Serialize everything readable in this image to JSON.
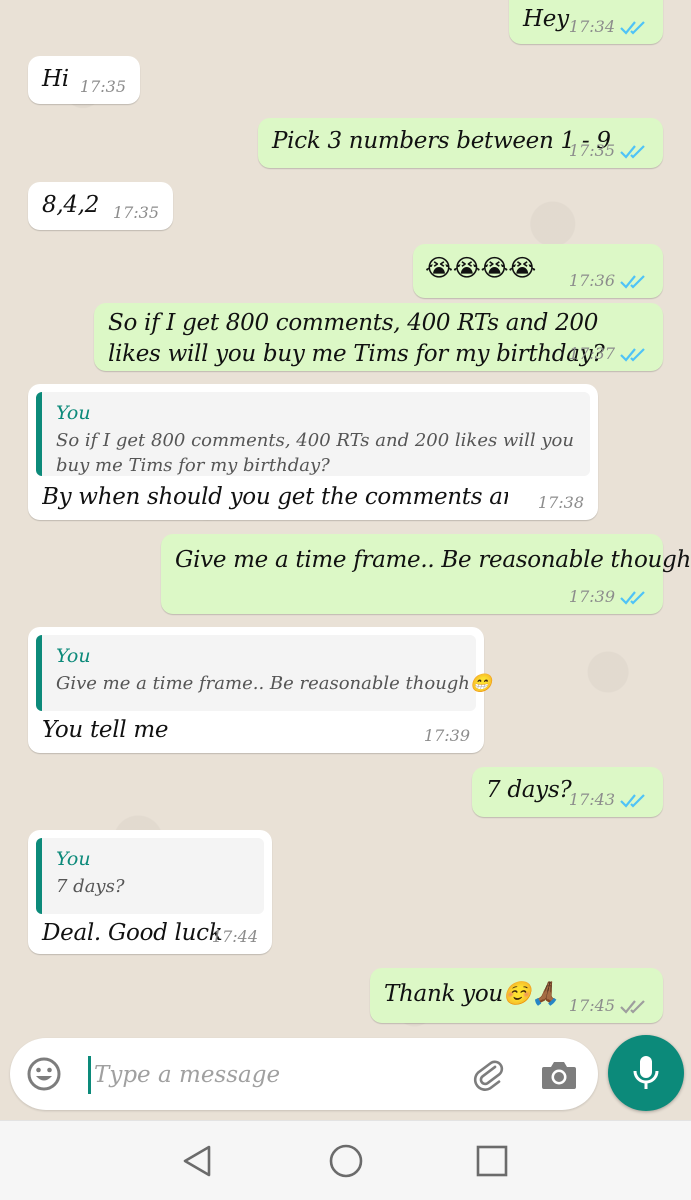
{
  "messages": [
    {
      "id": "m1",
      "dir": "out",
      "text": "Hey",
      "time": "17:34",
      "read": true
    },
    {
      "id": "m2",
      "dir": "in",
      "text": "Hi",
      "time": "17:35"
    },
    {
      "id": "m3",
      "dir": "out",
      "text": "Pick 3 numbers between 1 - 9",
      "time": "17:35",
      "read": true
    },
    {
      "id": "m4",
      "dir": "in",
      "text": "8,4,2",
      "time": "17:35"
    },
    {
      "id": "m5",
      "dir": "out",
      "text": "😭😭😭😭",
      "time": "17:36",
      "read": true
    },
    {
      "id": "m6",
      "dir": "out",
      "text": "So if I get 800 comments, 400 RTs and 200 likes will you buy me Tims for my birthday?",
      "time": "17:37",
      "read": true
    },
    {
      "id": "m7",
      "dir": "in",
      "quote_author": "You",
      "quote_text": "So if I get 800 comments, 400 RTs and 200 likes will you buy me Tims for my birthday?",
      "text": "By when should you get the comments and RTs?",
      "time": "17:38"
    },
    {
      "id": "m8",
      "dir": "out",
      "text": "Give me a time frame.. Be reasonable though😁",
      "time": "17:39",
      "read": true
    },
    {
      "id": "m9",
      "dir": "in",
      "quote_author": "You",
      "quote_text": "Give me a time frame.. Be reasonable though😁",
      "text": "You tell me",
      "time": "17:39"
    },
    {
      "id": "m10",
      "dir": "out",
      "text": "7 days?",
      "time": "17:43",
      "read": true
    },
    {
      "id": "m11",
      "dir": "in",
      "quote_author": "You",
      "quote_text": "7 days?",
      "text": "Deal. Good luck",
      "time": "17:44"
    },
    {
      "id": "m12",
      "dir": "out",
      "text": "Thank you☺️🙏🏾",
      "time": "17:45",
      "read": false
    }
  ],
  "composer": {
    "placeholder": "Type a message",
    "emoji_icon": "smiley-icon",
    "attach_icon": "paperclip-icon",
    "camera_icon": "camera-icon",
    "mic_icon": "microphone-icon"
  },
  "colors": {
    "outgoing_bubble": "#dcf8c6",
    "incoming_bubble": "#ffffff",
    "accent": "#0c8a7a",
    "read_ticks": "#4fc3f7",
    "unread_ticks": "#9e9e9e"
  }
}
